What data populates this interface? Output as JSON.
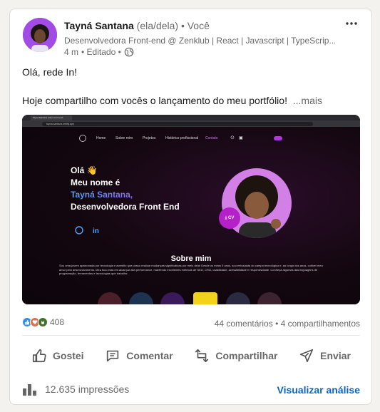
{
  "post": {
    "author": {
      "name": "Tayná Santana",
      "pronouns": "(ela/dela)",
      "degree": "• Você",
      "headline": "Desenvolvedora Front-end @ Zenklub | React | Javascript | TypeScrip...",
      "time": "4 m",
      "edited": "• Editado •"
    },
    "more_menu_icon": "ellipsis-icon",
    "body": {
      "line1": "Olá, rede In!",
      "line2": "Hoje compartilho com vocês o lançamento do meu portfólio!",
      "more": "...mais"
    },
    "media": {
      "tab_title": "Tayná Santana | Dev. Front-end",
      "url": "tayna-santana.netlify.app",
      "nav": [
        "Home",
        "Sobre mim",
        "Projetos",
        "Histórico profissional",
        "Contato"
      ],
      "hero_lines": [
        "Olá 👋",
        "Meu nome é",
        "Tayná Santana,",
        "Desenvolvedora Front End"
      ],
      "cv_label": "CV",
      "about_title": "Sobre mim",
      "about_text": "Sou uma jovem apaixonada por tecnologia e acredito que posso realizar mudanças significativas por meio dela! Desde os meus 9 anos, sou entusiasta do campo tecnológico e, ao longo dos anos, cultivei meu amor pelo desenvolvimento. Meu foco está em alcançar alta performance, mantendo excelentes métricas de SEO, CRO, usabilidade, acessibilidade e responsividade. Conheça algumas das linguagens de programação, ferramentas e tecnologias que trabalho:"
    },
    "social": {
      "reaction_count": "408",
      "comments": "44 comentários",
      "separator": " • ",
      "shares": "4 compartilhamentos"
    },
    "actions": {
      "like": "Gostei",
      "comment": "Comentar",
      "repost": "Compartilhar",
      "send": "Enviar"
    },
    "analytics": {
      "impressions": "12.635 impressões",
      "view": "Visualizar análise"
    }
  },
  "colors": {
    "link": "#0a66c2",
    "like_reaction": "#378fe9",
    "love_reaction": "#df704d",
    "support_reaction": "#44712e",
    "avatar_bg": "#a24ce6",
    "site_accent": "#b036e0"
  }
}
